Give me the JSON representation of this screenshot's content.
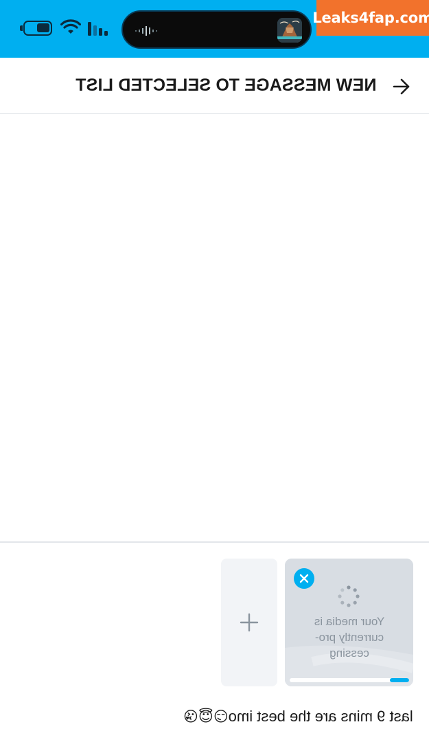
{
  "status_bar": {
    "icons": [
      "battery-icon",
      "wifi-icon",
      "cellular-signal-icon"
    ],
    "island": {
      "icons": [
        "audio-waveform-icon",
        "now-playing-thumbnail"
      ]
    },
    "background": "#00aff0"
  },
  "watermark": {
    "text": "Leaks4fap.com",
    "color": "#f2722c"
  },
  "header": {
    "title": "NEW MESSAGE TO SELECTED LIST",
    "back_icon": "arrow-icon"
  },
  "media": {
    "add_icon": "plus-icon",
    "remove_icon": "close-icon",
    "spinner_icon": "loading-spinner-icon",
    "processing_text": "Your media is currently pro-cessing",
    "progress": 0.16,
    "accent": "#00aff0"
  },
  "composer": {
    "text": "last 9 mins are the best imo",
    "emojis": "😏😇😘"
  }
}
